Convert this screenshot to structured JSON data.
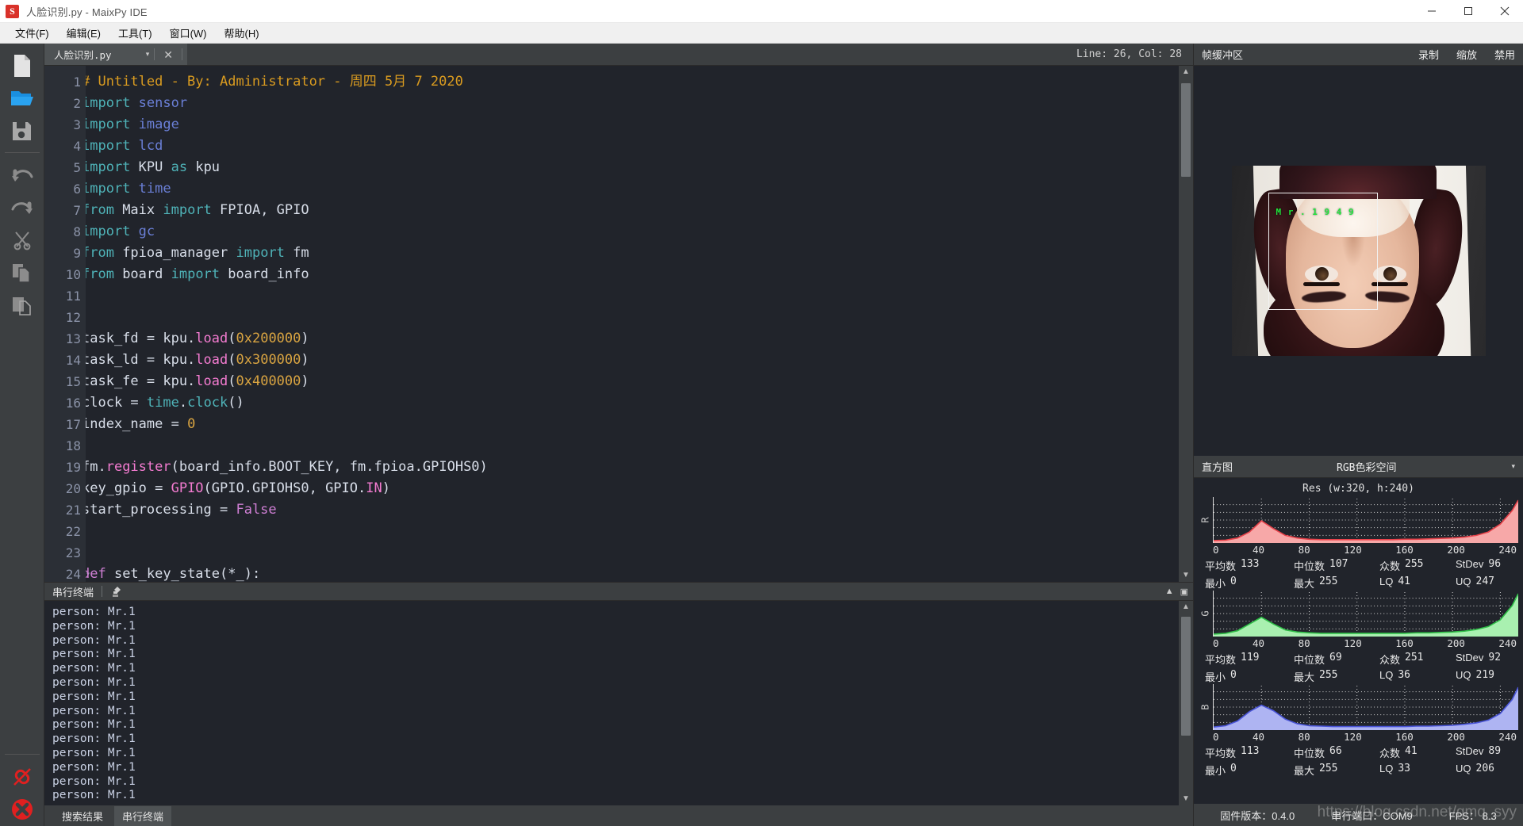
{
  "window": {
    "title": "人脸识别.py - MaixPy IDE",
    "logo_text": "S",
    "minimize": "—",
    "maximize": "▢",
    "close": "✕"
  },
  "menubar": {
    "items": [
      {
        "label": "文件(F)"
      },
      {
        "label": "编辑(E)"
      },
      {
        "label": "工具(T)"
      },
      {
        "label": "窗口(W)"
      },
      {
        "label": "帮助(H)"
      }
    ]
  },
  "toolrail": {
    "items": [
      {
        "name": "new-file-icon",
        "tooltip": "新建"
      },
      {
        "name": "open-folder-icon",
        "tooltip": "打开"
      },
      {
        "name": "save-icon",
        "tooltip": "保存"
      },
      {
        "name": "undo-icon",
        "tooltip": "撤销"
      },
      {
        "name": "redo-icon",
        "tooltip": "重做"
      },
      {
        "name": "cut-icon",
        "tooltip": "剪切"
      },
      {
        "name": "copy-icon",
        "tooltip": "复制"
      },
      {
        "name": "paste-icon",
        "tooltip": "粘贴"
      }
    ],
    "bottom": [
      {
        "name": "disconnect-icon",
        "tooltip": "断开连接"
      },
      {
        "name": "stop-icon",
        "tooltip": "停止"
      }
    ]
  },
  "editor": {
    "tab": {
      "label": "人脸识别.py",
      "caret": "▾",
      "close": "✕"
    },
    "cursor_position": "Line: 26, Col: 28",
    "lines": [
      {
        "n": "1",
        "fold": "",
        "tokens": [
          {
            "t": "# Untitled - By: Administrator - 周四 5月 7 2020",
            "c": "k-comment"
          }
        ]
      },
      {
        "n": "2",
        "fold": "",
        "tokens": [
          {
            "t": "import ",
            "c": "k-kw"
          },
          {
            "t": "sensor",
            "c": "k-mod"
          }
        ]
      },
      {
        "n": "3",
        "fold": "",
        "tokens": [
          {
            "t": "import ",
            "c": "k-kw"
          },
          {
            "t": "image",
            "c": "k-mod"
          }
        ]
      },
      {
        "n": "4",
        "fold": "",
        "tokens": [
          {
            "t": "import ",
            "c": "k-kw"
          },
          {
            "t": "lcd",
            "c": "k-mod"
          }
        ]
      },
      {
        "n": "5",
        "fold": "",
        "tokens": [
          {
            "t": "import ",
            "c": "k-kw"
          },
          {
            "t": "KPU ",
            "c": "k-plain"
          },
          {
            "t": "as ",
            "c": "k-kw"
          },
          {
            "t": "kpu",
            "c": "k-plain"
          }
        ]
      },
      {
        "n": "6",
        "fold": "",
        "tokens": [
          {
            "t": "import ",
            "c": "k-kw"
          },
          {
            "t": "time",
            "c": "k-mod"
          }
        ]
      },
      {
        "n": "7",
        "fold": "",
        "tokens": [
          {
            "t": "from ",
            "c": "k-kw"
          },
          {
            "t": "Maix ",
            "c": "k-plain"
          },
          {
            "t": "import ",
            "c": "k-kw"
          },
          {
            "t": "FPIOA, GPIO",
            "c": "k-plain"
          }
        ]
      },
      {
        "n": "8",
        "fold": "",
        "tokens": [
          {
            "t": "import ",
            "c": "k-kw"
          },
          {
            "t": "gc",
            "c": "k-mod"
          }
        ]
      },
      {
        "n": "9",
        "fold": "",
        "tokens": [
          {
            "t": "from ",
            "c": "k-kw"
          },
          {
            "t": "fpioa_manager ",
            "c": "k-plain"
          },
          {
            "t": "import ",
            "c": "k-kw"
          },
          {
            "t": "fm",
            "c": "k-plain"
          }
        ]
      },
      {
        "n": "10",
        "fold": "",
        "tokens": [
          {
            "t": "from ",
            "c": "k-kw"
          },
          {
            "t": "board ",
            "c": "k-plain"
          },
          {
            "t": "import ",
            "c": "k-kw"
          },
          {
            "t": "board_info",
            "c": "k-plain"
          }
        ]
      },
      {
        "n": "11",
        "fold": "",
        "tokens": []
      },
      {
        "n": "12",
        "fold": "",
        "tokens": []
      },
      {
        "n": "13",
        "fold": "",
        "tokens": [
          {
            "t": "task_fd = kpu.",
            "c": "k-plain"
          },
          {
            "t": "load",
            "c": "k-fn"
          },
          {
            "t": "(",
            "c": "k-plain"
          },
          {
            "t": "0x200000",
            "c": "k-num"
          },
          {
            "t": ")",
            "c": "k-plain"
          }
        ]
      },
      {
        "n": "14",
        "fold": "",
        "tokens": [
          {
            "t": "task_ld = kpu.",
            "c": "k-plain"
          },
          {
            "t": "load",
            "c": "k-fn"
          },
          {
            "t": "(",
            "c": "k-plain"
          },
          {
            "t": "0x300000",
            "c": "k-num"
          },
          {
            "t": ")",
            "c": "k-plain"
          }
        ]
      },
      {
        "n": "15",
        "fold": "",
        "tokens": [
          {
            "t": "task_fe = kpu.",
            "c": "k-plain"
          },
          {
            "t": "load",
            "c": "k-fn"
          },
          {
            "t": "(",
            "c": "k-plain"
          },
          {
            "t": "0x400000",
            "c": "k-num"
          },
          {
            "t": ")",
            "c": "k-plain"
          }
        ]
      },
      {
        "n": "16",
        "fold": "",
        "tokens": [
          {
            "t": "clock = ",
            "c": "k-plain"
          },
          {
            "t": "time",
            "c": "k-kw"
          },
          {
            "t": ".",
            "c": "k-plain"
          },
          {
            "t": "clock",
            "c": "k-kw"
          },
          {
            "t": "()",
            "c": "k-plain"
          }
        ]
      },
      {
        "n": "17",
        "fold": "",
        "tokens": [
          {
            "t": "index_name = ",
            "c": "k-plain"
          },
          {
            "t": "0",
            "c": "k-num"
          }
        ]
      },
      {
        "n": "18",
        "fold": "",
        "tokens": []
      },
      {
        "n": "19",
        "fold": "",
        "tokens": [
          {
            "t": "fm.",
            "c": "k-plain"
          },
          {
            "t": "register",
            "c": "k-fn"
          },
          {
            "t": "(board_info.BOOT_KEY, fm.fpioa.GPIOHS0)",
            "c": "k-plain"
          }
        ]
      },
      {
        "n": "20",
        "fold": "",
        "tokens": [
          {
            "t": "key_gpio = ",
            "c": "k-plain"
          },
          {
            "t": "GPIO",
            "c": "k-fn"
          },
          {
            "t": "(GPIO.GPIOHS0, GPIO.",
            "c": "k-plain"
          },
          {
            "t": "IN",
            "c": "k-fn"
          },
          {
            "t": ")",
            "c": "k-plain"
          }
        ]
      },
      {
        "n": "21",
        "fold": "",
        "tokens": [
          {
            "t": "start_processing = ",
            "c": "k-plain"
          },
          {
            "t": "False",
            "c": "k-kw2"
          }
        ]
      },
      {
        "n": "22",
        "fold": "",
        "tokens": []
      },
      {
        "n": "23",
        "fold": "",
        "tokens": []
      },
      {
        "n": "24",
        "fold": "▾",
        "tokens": [
          {
            "t": "def ",
            "c": "k-kw2"
          },
          {
            "t": "set_key_state",
            "c": "k-plain"
          },
          {
            "t": "(*_):",
            "c": "k-plain"
          }
        ]
      }
    ]
  },
  "terminal": {
    "title": "串行终端",
    "clear_icon": "broom-icon",
    "output": "person: Mr.1\nperson: Mr.1\nperson: Mr.1\nperson: Mr.1\nperson: Mr.1\nperson: Mr.1\nperson: Mr.1\nperson: Mr.1\nperson: Mr.1\nperson: Mr.1\nperson: Mr.1\nperson: Mr.1\nperson: Mr.1\nperson: Mr.1"
  },
  "bottom_tabs": [
    {
      "label": "搜索结果",
      "active": false
    },
    {
      "label": "串行终端",
      "active": true
    }
  ],
  "framebuffer": {
    "title": "帧缓冲区",
    "actions": [
      {
        "label": "录制"
      },
      {
        "label": "缩放"
      },
      {
        "label": "禁用"
      }
    ],
    "overlay_text": "M r . 1   9 4   9",
    "image_size": "320x240"
  },
  "histogram": {
    "title": "直方图",
    "colorspace": "RGB色彩空间",
    "caret": "▾",
    "resolution": "Res (w:320, h:240)",
    "labels": {
      "mean": "平均数",
      "median": "中位数",
      "mode": "众数",
      "stdev": "StDev",
      "min": "最小",
      "max": "最大",
      "lq": "LQ",
      "uq": "UQ"
    }
  },
  "chart_data": [
    {
      "type": "area",
      "title": "R",
      "channel": "R",
      "color": "#f7a8a8",
      "line_color": "#e8424a",
      "xlabel": "",
      "ylabel": "R",
      "xlim": [
        0,
        255
      ],
      "ticks": [
        "0",
        "40",
        "80",
        "120",
        "160",
        "200",
        "240"
      ],
      "x": [
        0,
        10,
        20,
        30,
        40,
        50,
        60,
        70,
        80,
        90,
        100,
        110,
        120,
        130,
        140,
        150,
        160,
        170,
        180,
        190,
        200,
        210,
        220,
        230,
        240,
        250,
        255
      ],
      "values": [
        2,
        3,
        8,
        22,
        48,
        30,
        14,
        8,
        5,
        4,
        4,
        4,
        4,
        4,
        4,
        4,
        5,
        5,
        6,
        7,
        8,
        10,
        14,
        22,
        40,
        72,
        96
      ],
      "stats": {
        "mean": 133,
        "median": 107,
        "mode": 255,
        "stdev": 96,
        "min": 0,
        "max": 255,
        "lq": 41,
        "uq": 247
      }
    },
    {
      "type": "area",
      "title": "G",
      "channel": "G",
      "color": "#a9f0b0",
      "line_color": "#2fbf47",
      "xlabel": "",
      "ylabel": "G",
      "xlim": [
        0,
        255
      ],
      "ticks": [
        "0",
        "40",
        "80",
        "120",
        "160",
        "200",
        "240"
      ],
      "x": [
        0,
        10,
        20,
        30,
        40,
        50,
        60,
        70,
        80,
        90,
        100,
        110,
        120,
        130,
        140,
        150,
        160,
        170,
        180,
        190,
        200,
        210,
        220,
        230,
        240,
        250,
        255
      ],
      "values": [
        2,
        4,
        10,
        26,
        42,
        26,
        12,
        7,
        5,
        4,
        4,
        4,
        4,
        4,
        4,
        4,
        4,
        5,
        5,
        6,
        7,
        9,
        13,
        20,
        36,
        70,
        98
      ],
      "stats": {
        "mean": 119,
        "median": 69,
        "mode": 251,
        "stdev": 92,
        "min": 0,
        "max": 255,
        "lq": 36,
        "uq": 219
      }
    },
    {
      "type": "area",
      "title": "B",
      "channel": "B",
      "color": "#aeb4f2",
      "line_color": "#4a55d8",
      "xlabel": "",
      "ylabel": "B",
      "xlim": [
        0,
        255
      ],
      "ticks": [
        "0",
        "40",
        "80",
        "120",
        "160",
        "200",
        "240"
      ],
      "x": [
        0,
        10,
        20,
        30,
        40,
        50,
        60,
        70,
        80,
        90,
        100,
        110,
        120,
        130,
        140,
        150,
        160,
        170,
        180,
        190,
        200,
        210,
        220,
        230,
        240,
        250,
        255
      ],
      "values": [
        3,
        6,
        16,
        36,
        50,
        38,
        20,
        10,
        6,
        5,
        4,
        4,
        4,
        4,
        4,
        4,
        4,
        5,
        5,
        6,
        7,
        9,
        12,
        18,
        32,
        62,
        88
      ],
      "stats": {
        "mean": 113,
        "median": 66,
        "mode": 41,
        "stdev": 89,
        "min": 0,
        "max": 255,
        "lq": 33,
        "uq": 206
      }
    }
  ],
  "statusbar": {
    "firmware": "固件版本：0.4.0",
    "port": "串行端口：COM9",
    "fps": "FPS： 8.3",
    "watermark": "https://blog.csdn.net/gmq_syy"
  }
}
